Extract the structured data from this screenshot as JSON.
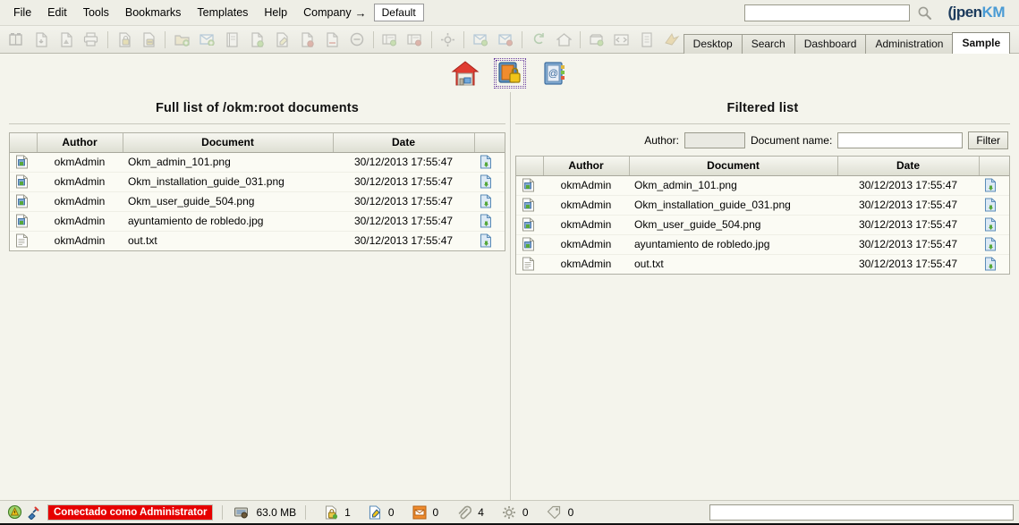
{
  "app": {
    "title": "OpenKM",
    "logo_open": "(jpen",
    "logo_km": "KM"
  },
  "menubar": {
    "items": [
      {
        "label": "File",
        "name": "menu-file"
      },
      {
        "label": "Edit",
        "name": "menu-edit"
      },
      {
        "label": "Tools",
        "name": "menu-tools"
      },
      {
        "label": "Bookmarks",
        "name": "menu-bookmarks"
      },
      {
        "label": "Templates",
        "name": "menu-templates"
      },
      {
        "label": "Help",
        "name": "menu-help"
      }
    ],
    "company_label": "Company",
    "company_arrow": "→",
    "company_value": "Default",
    "search_value": "",
    "search_placeholder": ""
  },
  "toolbar": {
    "groups": [
      {
        "icons": [
          "find-folder-icon",
          "document-download-icon",
          "document-pdf-icon",
          "print-icon"
        ]
      },
      {
        "icons": [
          "lock-add-icon",
          "lock-remove-icon"
        ]
      },
      {
        "icons": [
          "folder-add-icon",
          "mail-add-icon",
          "note-add-icon",
          "document-add-icon",
          "document-edit-icon",
          "document-remove-icon",
          "document-delete-icon",
          "cancel-icon"
        ]
      },
      {
        "icons": [
          "record-add-icon",
          "record-remove-icon"
        ]
      },
      {
        "icons": [
          "settings-icon"
        ]
      },
      {
        "icons": [
          "subscribe-add-icon",
          "subscribe-remove-icon"
        ]
      },
      {
        "icons": [
          "refresh-icon",
          "home-icon"
        ]
      },
      {
        "icons": [
          "archive-add-icon",
          "split-icon",
          "properties-icon",
          "export-icon"
        ]
      }
    ],
    "tabs": [
      {
        "label": "Desktop",
        "name": "tab-desktop",
        "active": false
      },
      {
        "label": "Search",
        "name": "tab-search",
        "active": false
      },
      {
        "label": "Dashboard",
        "name": "tab-dashboard",
        "active": false
      },
      {
        "label": "Administration",
        "name": "tab-administration",
        "active": false
      },
      {
        "label": "Sample",
        "name": "tab-sample",
        "active": true
      }
    ]
  },
  "iconstrip": {
    "items": [
      {
        "name": "home-house-icon",
        "selected": false
      },
      {
        "name": "secure-document-icon",
        "selected": true
      },
      {
        "name": "address-book-icon",
        "selected": false
      }
    ]
  },
  "left_panel": {
    "title": "Full list of /okm:root documents",
    "columns": [
      "",
      "Author",
      "Document",
      "Date",
      ""
    ],
    "rows": [
      {
        "icon": "image-file-icon",
        "author": "okmAdmin",
        "document": "Okm_admin_101.png",
        "date": "30/12/2013 17:55:47",
        "action": "download-icon"
      },
      {
        "icon": "image-file-icon",
        "author": "okmAdmin",
        "document": "Okm_installation_guide_031.png",
        "date": "30/12/2013 17:55:47",
        "action": "download-icon"
      },
      {
        "icon": "image-file-icon",
        "author": "okmAdmin",
        "document": "Okm_user_guide_504.png",
        "date": "30/12/2013 17:55:47",
        "action": "download-icon"
      },
      {
        "icon": "image-file-icon",
        "author": "okmAdmin",
        "document": "ayuntamiento de robledo.jpg",
        "date": "30/12/2013 17:55:47",
        "action": "download-icon"
      },
      {
        "icon": "text-file-icon",
        "author": "okmAdmin",
        "document": "out.txt",
        "date": "30/12/2013 17:55:47",
        "action": "download-icon"
      }
    ]
  },
  "right_panel": {
    "title": "Filtered list",
    "filter": {
      "author_label": "Author:",
      "author_value": "",
      "docname_label": "Document name:",
      "docname_value": "",
      "button_label": "Filter"
    },
    "columns": [
      "",
      "Author",
      "Document",
      "Date",
      ""
    ],
    "rows": [
      {
        "icon": "image-file-icon",
        "author": "okmAdmin",
        "document": "Okm_admin_101.png",
        "date": "30/12/2013 17:55:47",
        "action": "download-icon"
      },
      {
        "icon": "image-file-icon",
        "author": "okmAdmin",
        "document": "Okm_installation_guide_031.png",
        "date": "30/12/2013 17:55:47",
        "action": "download-icon"
      },
      {
        "icon": "image-file-icon",
        "author": "okmAdmin",
        "document": "Okm_user_guide_504.png",
        "date": "30/12/2013 17:55:47",
        "action": "download-icon"
      },
      {
        "icon": "image-file-icon",
        "author": "okmAdmin",
        "document": "ayuntamiento de robledo.jpg",
        "date": "30/12/2013 17:55:47",
        "action": "download-icon"
      },
      {
        "icon": "text-file-icon",
        "author": "okmAdmin",
        "document": "out.txt",
        "date": "30/12/2013 17:55:47",
        "action": "download-icon"
      }
    ]
  },
  "statusbar": {
    "connected_text": "Conectado como Administrator",
    "memory": "63.0 MB",
    "counters": [
      {
        "icon": "lock-green-icon",
        "value": "1"
      },
      {
        "icon": "pencil-edit-icon",
        "value": "0"
      },
      {
        "icon": "mail-orange-icon",
        "value": "0"
      },
      {
        "icon": "paperclip-icon",
        "value": "4"
      },
      {
        "icon": "gear-icon",
        "value": "0"
      },
      {
        "icon": "tag-icon",
        "value": "0"
      }
    ],
    "input_value": ""
  },
  "colors": {
    "accent_red": "#e60000",
    "brand_blue": "#4a9bd4",
    "brand_dark": "#1b3a5c",
    "background": "#f4f4ec",
    "chrome": "#eeeee6"
  }
}
